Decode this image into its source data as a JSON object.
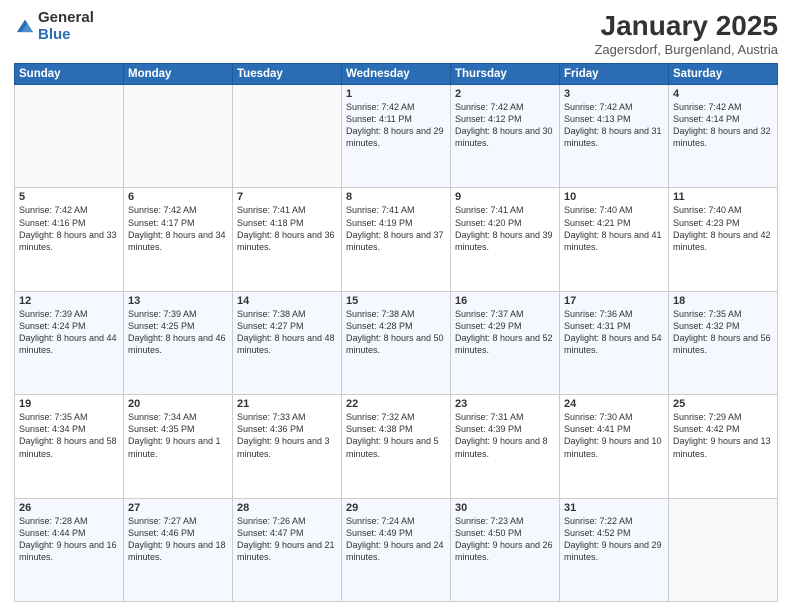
{
  "header": {
    "logo_general": "General",
    "logo_blue": "Blue",
    "month_title": "January 2025",
    "location": "Zagersdorf, Burgenland, Austria"
  },
  "weekdays": [
    "Sunday",
    "Monday",
    "Tuesday",
    "Wednesday",
    "Thursday",
    "Friday",
    "Saturday"
  ],
  "weeks": [
    [
      {
        "day": "",
        "info": ""
      },
      {
        "day": "",
        "info": ""
      },
      {
        "day": "",
        "info": ""
      },
      {
        "day": "1",
        "info": "Sunrise: 7:42 AM\nSunset: 4:11 PM\nDaylight: 8 hours and 29 minutes."
      },
      {
        "day": "2",
        "info": "Sunrise: 7:42 AM\nSunset: 4:12 PM\nDaylight: 8 hours and 30 minutes."
      },
      {
        "day": "3",
        "info": "Sunrise: 7:42 AM\nSunset: 4:13 PM\nDaylight: 8 hours and 31 minutes."
      },
      {
        "day": "4",
        "info": "Sunrise: 7:42 AM\nSunset: 4:14 PM\nDaylight: 8 hours and 32 minutes."
      }
    ],
    [
      {
        "day": "5",
        "info": "Sunrise: 7:42 AM\nSunset: 4:16 PM\nDaylight: 8 hours and 33 minutes."
      },
      {
        "day": "6",
        "info": "Sunrise: 7:42 AM\nSunset: 4:17 PM\nDaylight: 8 hours and 34 minutes."
      },
      {
        "day": "7",
        "info": "Sunrise: 7:41 AM\nSunset: 4:18 PM\nDaylight: 8 hours and 36 minutes."
      },
      {
        "day": "8",
        "info": "Sunrise: 7:41 AM\nSunset: 4:19 PM\nDaylight: 8 hours and 37 minutes."
      },
      {
        "day": "9",
        "info": "Sunrise: 7:41 AM\nSunset: 4:20 PM\nDaylight: 8 hours and 39 minutes."
      },
      {
        "day": "10",
        "info": "Sunrise: 7:40 AM\nSunset: 4:21 PM\nDaylight: 8 hours and 41 minutes."
      },
      {
        "day": "11",
        "info": "Sunrise: 7:40 AM\nSunset: 4:23 PM\nDaylight: 8 hours and 42 minutes."
      }
    ],
    [
      {
        "day": "12",
        "info": "Sunrise: 7:39 AM\nSunset: 4:24 PM\nDaylight: 8 hours and 44 minutes."
      },
      {
        "day": "13",
        "info": "Sunrise: 7:39 AM\nSunset: 4:25 PM\nDaylight: 8 hours and 46 minutes."
      },
      {
        "day": "14",
        "info": "Sunrise: 7:38 AM\nSunset: 4:27 PM\nDaylight: 8 hours and 48 minutes."
      },
      {
        "day": "15",
        "info": "Sunrise: 7:38 AM\nSunset: 4:28 PM\nDaylight: 8 hours and 50 minutes."
      },
      {
        "day": "16",
        "info": "Sunrise: 7:37 AM\nSunset: 4:29 PM\nDaylight: 8 hours and 52 minutes."
      },
      {
        "day": "17",
        "info": "Sunrise: 7:36 AM\nSunset: 4:31 PM\nDaylight: 8 hours and 54 minutes."
      },
      {
        "day": "18",
        "info": "Sunrise: 7:35 AM\nSunset: 4:32 PM\nDaylight: 8 hours and 56 minutes."
      }
    ],
    [
      {
        "day": "19",
        "info": "Sunrise: 7:35 AM\nSunset: 4:34 PM\nDaylight: 8 hours and 58 minutes."
      },
      {
        "day": "20",
        "info": "Sunrise: 7:34 AM\nSunset: 4:35 PM\nDaylight: 9 hours and 1 minute."
      },
      {
        "day": "21",
        "info": "Sunrise: 7:33 AM\nSunset: 4:36 PM\nDaylight: 9 hours and 3 minutes."
      },
      {
        "day": "22",
        "info": "Sunrise: 7:32 AM\nSunset: 4:38 PM\nDaylight: 9 hours and 5 minutes."
      },
      {
        "day": "23",
        "info": "Sunrise: 7:31 AM\nSunset: 4:39 PM\nDaylight: 9 hours and 8 minutes."
      },
      {
        "day": "24",
        "info": "Sunrise: 7:30 AM\nSunset: 4:41 PM\nDaylight: 9 hours and 10 minutes."
      },
      {
        "day": "25",
        "info": "Sunrise: 7:29 AM\nSunset: 4:42 PM\nDaylight: 9 hours and 13 minutes."
      }
    ],
    [
      {
        "day": "26",
        "info": "Sunrise: 7:28 AM\nSunset: 4:44 PM\nDaylight: 9 hours and 16 minutes."
      },
      {
        "day": "27",
        "info": "Sunrise: 7:27 AM\nSunset: 4:46 PM\nDaylight: 9 hours and 18 minutes."
      },
      {
        "day": "28",
        "info": "Sunrise: 7:26 AM\nSunset: 4:47 PM\nDaylight: 9 hours and 21 minutes."
      },
      {
        "day": "29",
        "info": "Sunrise: 7:24 AM\nSunset: 4:49 PM\nDaylight: 9 hours and 24 minutes."
      },
      {
        "day": "30",
        "info": "Sunrise: 7:23 AM\nSunset: 4:50 PM\nDaylight: 9 hours and 26 minutes."
      },
      {
        "day": "31",
        "info": "Sunrise: 7:22 AM\nSunset: 4:52 PM\nDaylight: 9 hours and 29 minutes."
      },
      {
        "day": "",
        "info": ""
      }
    ]
  ]
}
